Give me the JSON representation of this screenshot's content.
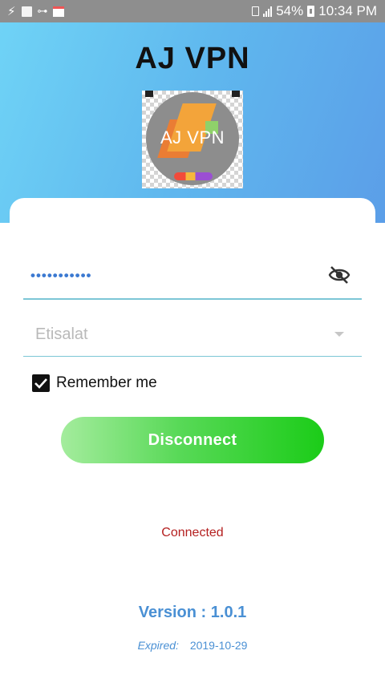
{
  "status_bar": {
    "battery": "54%",
    "time": "10:34 PM"
  },
  "header": {
    "app_title": "AJ VPN",
    "logo_text": "AJ VPN"
  },
  "form": {
    "password_value": "•••••••••••",
    "server_select": {
      "selected": "Etisalat"
    },
    "remember_label": "Remember me",
    "remember_checked": true,
    "connect_button_label": "Disconnect"
  },
  "connection_status": "Connected",
  "footer": {
    "version": "Version : 1.0.1",
    "expired_label": "Expired:",
    "expired_date": "2019-10-29"
  },
  "colors": {
    "header_gradient_start": "#6fd3f6",
    "header_gradient_end": "#5b9ee8",
    "button_green": "#1bcc18",
    "status_red": "#b41f1f",
    "version_blue": "#4a90d4"
  }
}
